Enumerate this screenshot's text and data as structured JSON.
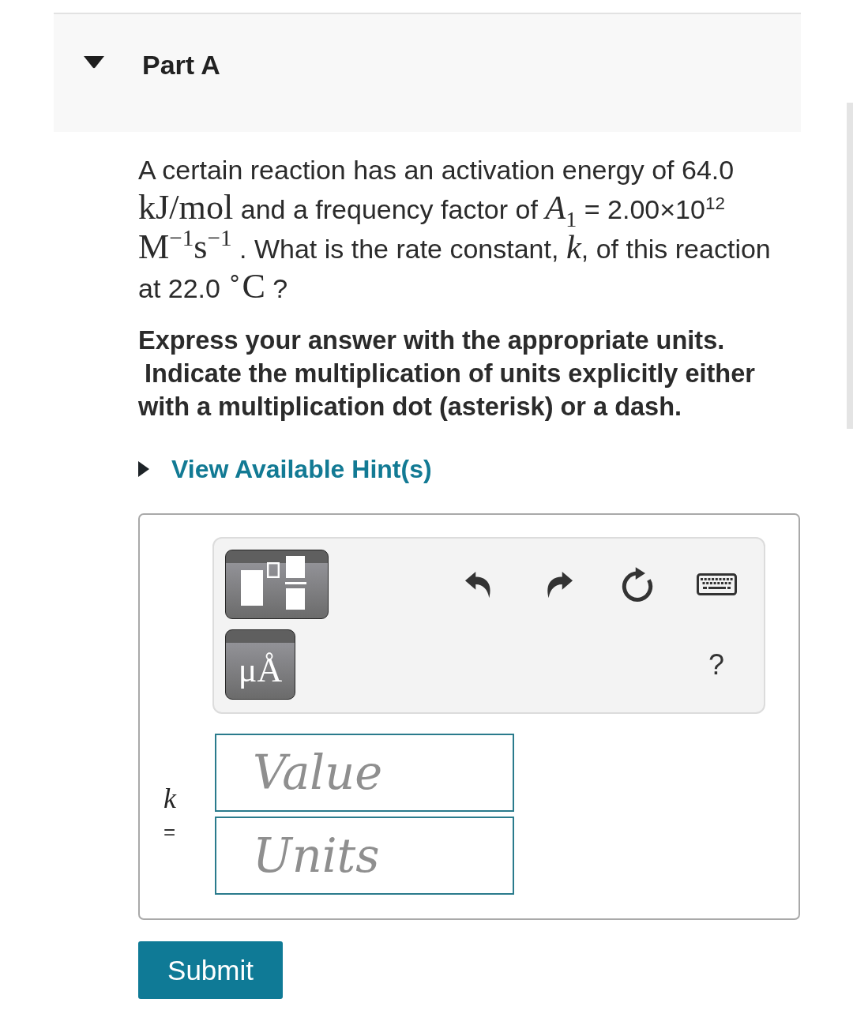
{
  "part": {
    "title": "Part A",
    "expanded": true
  },
  "question": [
    {
      "kind": "text",
      "text": "A certain reaction has an activation energy of 64.0 "
    },
    {
      "kind": "math",
      "text": "kJ/mol"
    },
    {
      "kind": "text",
      "text": " and a frequency factor of "
    },
    {
      "kind": "variable",
      "text": "A$_{1}$"
    },
    {
      "kind": "text",
      "text": " = 2.00×10$^{12}$ "
    },
    {
      "kind": "math",
      "text": "M$^{−1}$s$^{−1}$"
    },
    {
      "kind": "text",
      "text": " . What is the rate constant, "
    },
    {
      "kind": "variable",
      "text": "k"
    },
    {
      "kind": "text",
      "text": ", of this reaction at 22.0 "
    },
    {
      "kind": "math",
      "text": "$^{∘}$C"
    },
    {
      "kind": "text",
      "text": " ?"
    }
  ],
  "instructions": [
    "Express your answer with the appropriate units.",
    "Indicate the multiplication of units explicitly either with a multiplication dot (asterisk) or a dash."
  ],
  "hint": {
    "label": "View Available Hint(s)",
    "expanded": false
  },
  "answer": {
    "toolbar": {
      "tools": [
        {
          "kind": "templates"
        },
        {
          "kind": "units",
          "label": "μÅ"
        }
      ],
      "actions": [
        {
          "kind": "undo"
        },
        {
          "kind": "redo"
        },
        {
          "kind": "reset"
        },
        {
          "kind": "keyboard"
        }
      ],
      "help": "?"
    },
    "variable": "k",
    "equals": "=",
    "fields": [
      {
        "placeholder": "Value"
      },
      {
        "placeholder": "Units"
      }
    ]
  },
  "submit": {
    "label": "Submit"
  }
}
